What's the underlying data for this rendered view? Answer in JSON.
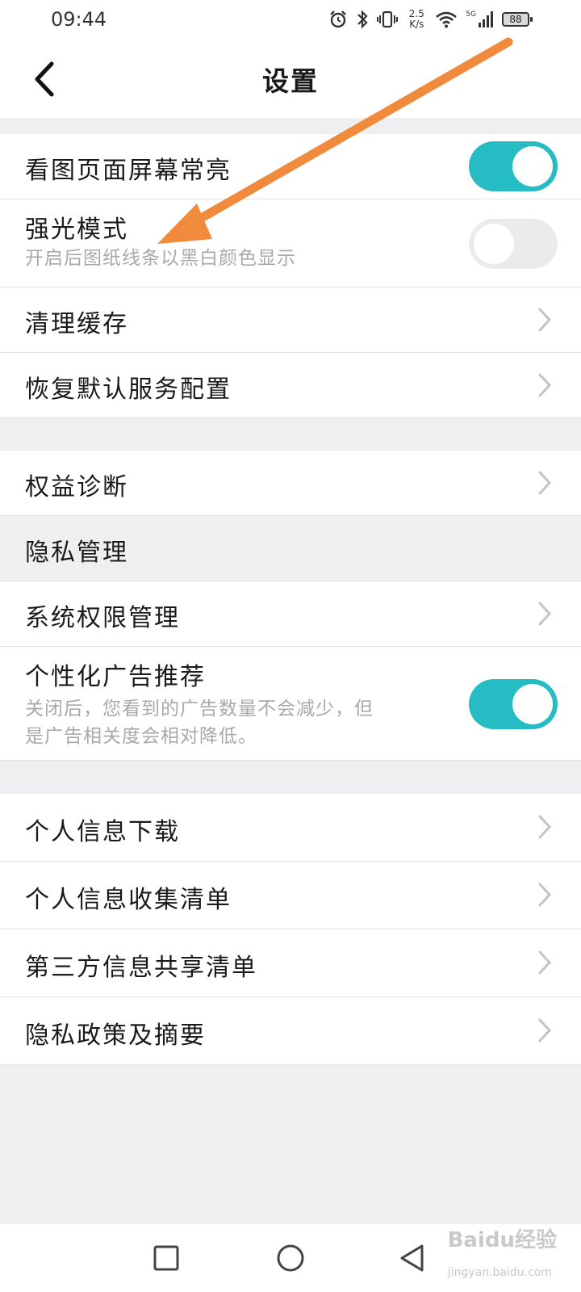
{
  "status_bar": {
    "time": "09:44",
    "net_speed_value": "2.5",
    "net_speed_unit": "K/s",
    "network_type": "5G",
    "battery": "88",
    "icons": [
      "alarm-icon",
      "bluetooth-icon",
      "vibrate-icon",
      "wifi-icon",
      "signal-icon",
      "battery-icon"
    ]
  },
  "header": {
    "title": "设置",
    "back_icon": "chevron-left-icon"
  },
  "settings": {
    "screen_on": {
      "label": "看图页面屏幕常亮",
      "enabled": true
    },
    "strong_light": {
      "label": "强光模式",
      "description": "开启后图纸线条以黑白颜色显示",
      "enabled": false
    },
    "clear_cache": {
      "label": "清理缓存"
    },
    "restore_service": {
      "label": "恢复默认服务配置"
    },
    "rights_diagnosis": {
      "label": "权益诊断"
    }
  },
  "privacy": {
    "section_title": "隐私管理",
    "system_permissions": {
      "label": "系统权限管理"
    },
    "personalized_ads": {
      "label": "个性化广告推荐",
      "description_line1": "关闭后，您看到的广告数量不会减少，但",
      "description_line2": "是广告相关度会相对降低。",
      "enabled": true
    },
    "personal_info_download": {
      "label": "个人信息下载"
    },
    "personal_info_list": {
      "label": "个人信息收集清单"
    },
    "third_party_list": {
      "label": "第三方信息共享清单"
    },
    "privacy_policy": {
      "label": "隐私政策及摘要"
    }
  },
  "system_nav": {
    "icons": [
      "recent-apps-icon",
      "home-icon",
      "back-icon"
    ]
  },
  "watermark": {
    "text": "Baidu经验",
    "sub": "jingyan.baidu.com"
  },
  "colors": {
    "accent": "#26bcc3",
    "annotation_arrow": "#f08a3c",
    "background": "#efeff1"
  }
}
